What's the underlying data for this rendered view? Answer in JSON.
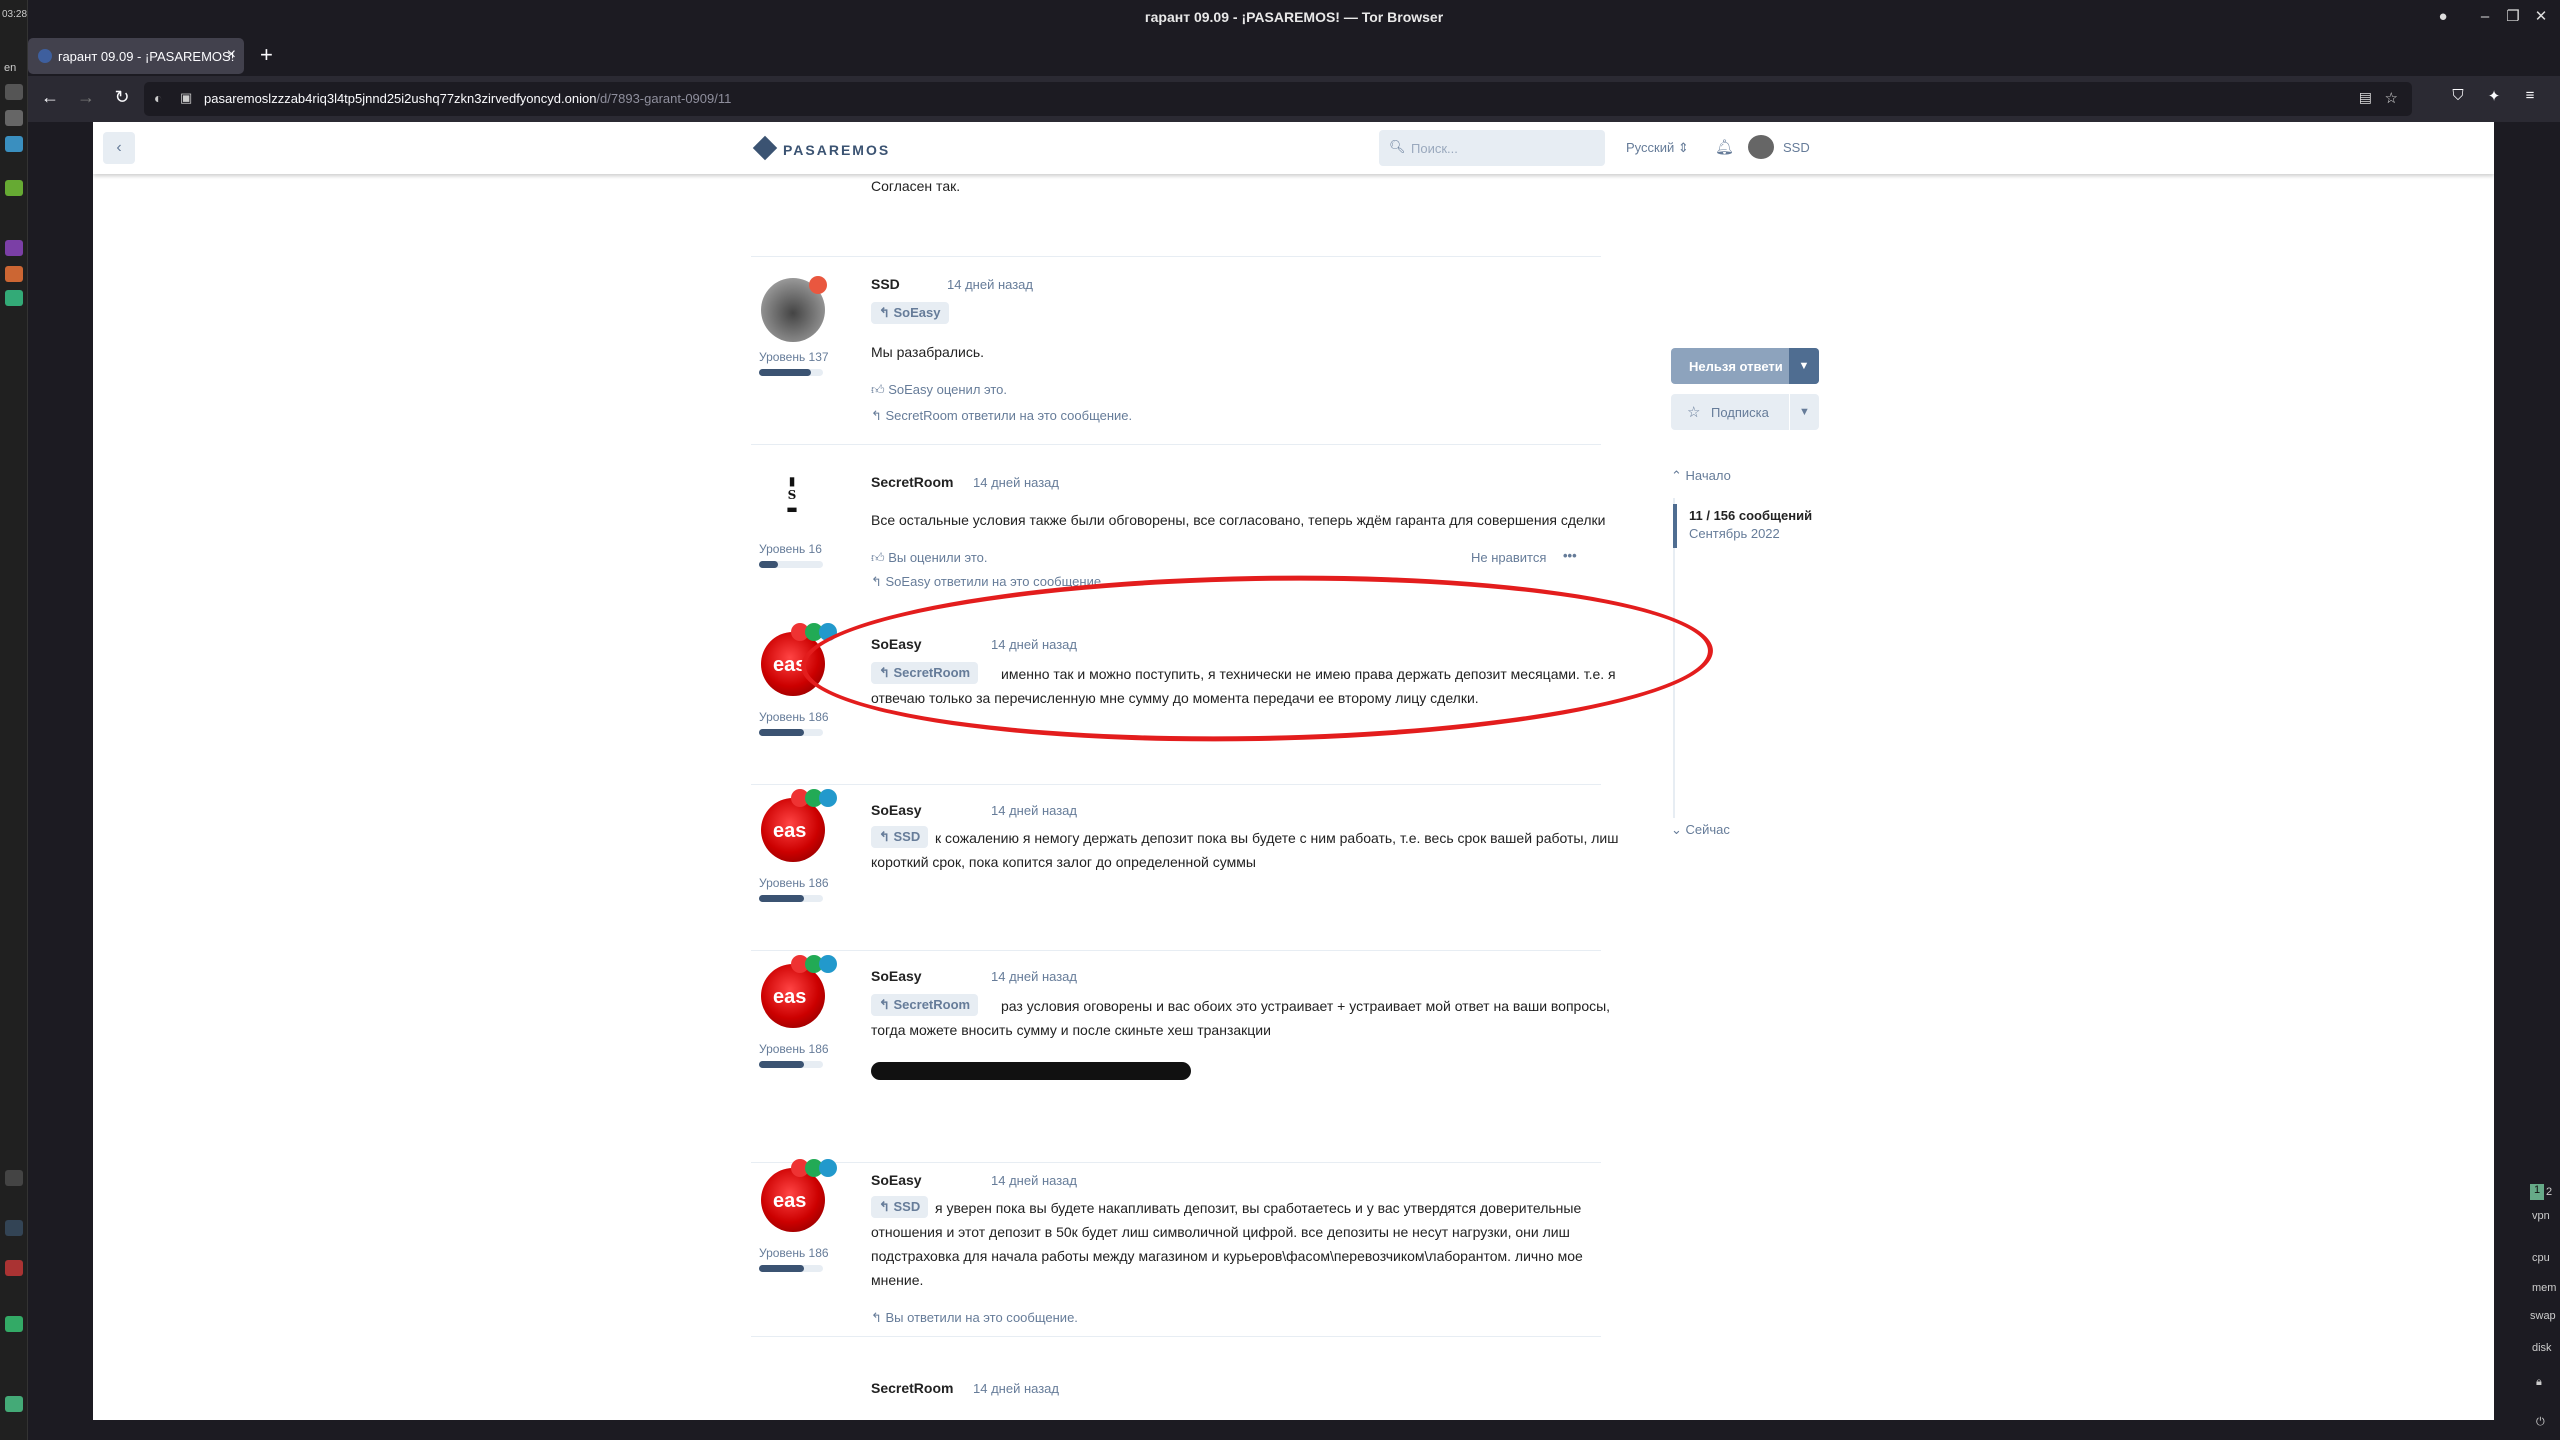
{
  "window": {
    "title": "гарант 09.09 - ¡PASAREMOS! — Tor Browser"
  },
  "desktop": {
    "clock": "03:28",
    "lang": "en",
    "ws1": "1",
    "ws2": "2",
    "vpn": "vpn",
    "cpu": "cpu",
    "mem": "mem",
    "swap": "swap",
    "disk": "disk"
  },
  "tab": {
    "title": "гарант 09.09 - ¡PASAREMOS!"
  },
  "address": {
    "host": "pasaremoslzzzab4riq3l4tp5jnnd25i2ushq77zkn3zirvedfyoncyd.onion",
    "path": "/d/7893-garant-0909/11"
  },
  "header": {
    "brand": "PASAREMOS",
    "search_placeholder": "Поиск...",
    "language": "Русский",
    "user": "SSD"
  },
  "posts": {
    "p0": {
      "body": "Согласен так."
    },
    "p1": {
      "author": "SSD",
      "time": "14 дней назад",
      "reply_to": "SoEasy",
      "level": "Уровень 137",
      "level_pct": 0.82,
      "body": "Мы разабрались.",
      "liked": "SoEasy оценил это.",
      "replied": "SecretRoom ответили на это сообщение."
    },
    "p2": {
      "author": "SecretRoom",
      "time": "14 дней назад",
      "level": "Уровень 16",
      "level_pct": 0.3,
      "body": "Все остальные условия также были обговорены, все согласовано, теперь ждём гаранта для совершения сделки",
      "liked": "Вы оценили это.",
      "dislike": "Не нравится",
      "more": "•••",
      "replied": "SoEasy ответили на это сообщение."
    },
    "p3": {
      "author": "SoEasy",
      "time": "14 дней назад",
      "reply_to": "SecretRoom",
      "level": "Уровень 186",
      "level_pct": 0.7,
      "body": "именно так и можно поступить, я технически не имею права держать депозит месяцами. т.е. я отвечаю только за перечисленную мне сумму до момента передачи ее второму лицу сделки."
    },
    "p4": {
      "author": "SoEasy",
      "time": "14 дней назад",
      "reply_to": "SSD",
      "level": "Уровень 186",
      "level_pct": 0.7,
      "body": "к сожалению я немогу держать депозит пока вы будете с ним рабоать, т.е. весь срок вашей работы, лиш короткий срок, пока копится залог до определенной суммы"
    },
    "p5": {
      "author": "SoEasy",
      "time": "14 дней назад",
      "reply_to": "SecretRoom",
      "level": "Уровень 186",
      "level_pct": 0.7,
      "body": "раз условия оговорены и вас обоих это устраивает + устраивает мой ответ на ваши вопросы, тогда можете вносить сумму и после скиньте хеш транзакции"
    },
    "p6": {
      "author": "SoEasy",
      "time": "14 дней назад",
      "reply_to": "SSD",
      "level": "Уровень 186",
      "level_pct": 0.7,
      "body": "я уверен пока вы будете накапливать депозит, вы сработаетесь и у вас утвердятся доверительные отношения и этот депозит в 50к будет лиш символичной цифрой. все депозиты не несут нагрузки, они лиш подстраховка для начала работы между магазином и курьеров\\фасом\\перевозчиком\\лаборантом. лично мое мнение.",
      "replied": "Вы ответили на это сообщение."
    },
    "p7": {
      "author": "SecretRoom",
      "time": "14 дней назад"
    }
  },
  "sidebar": {
    "reply": "Нельзя ответи",
    "subscribe": "Подписка",
    "start": "Начало",
    "position": "11 / 156 сообщений",
    "date": "Сентябрь 2022",
    "now": "Сейчас"
  },
  "colors": {
    "accent": "#4f6d91",
    "annotation": "#e31d1d"
  }
}
